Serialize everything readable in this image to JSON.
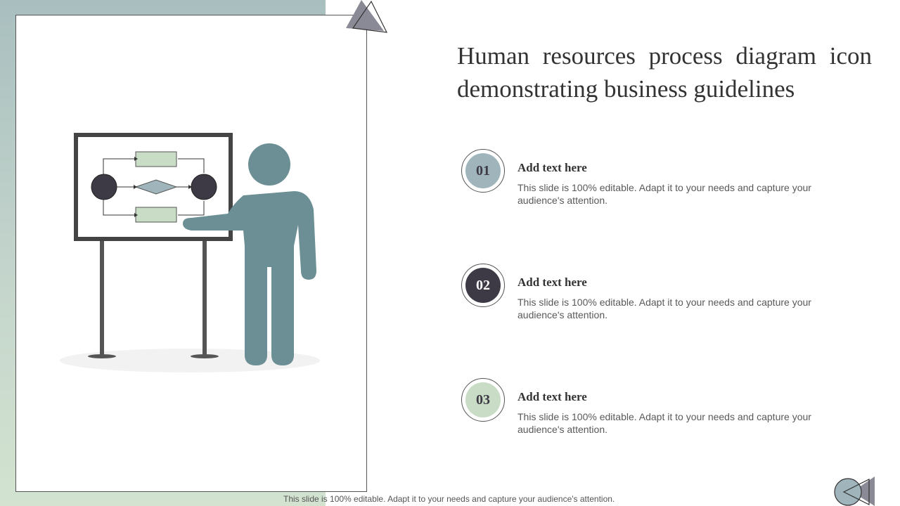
{
  "slide": {
    "title": "Human resources process diagram icon demonstrating  business guidelines",
    "items": [
      {
        "number": "01",
        "heading": "Add text here",
        "body": "This slide is 100% editable. Adapt it to your needs and capture your audience's attention.",
        "color": "#9fb5bb",
        "text_color": "#3d3a45"
      },
      {
        "number": "02",
        "heading": "Add text here",
        "body": "This slide is 100% editable. Adapt it to your needs and capture your audience's attention.",
        "color": "#3d3a45",
        "text_color": "#ffffff"
      },
      {
        "number": "03",
        "heading": "Add text here",
        "body": "This slide is 100% editable. Adapt it to your needs and capture your audience's attention.",
        "color": "#c9dcc5",
        "text_color": "#3d3a45"
      }
    ],
    "footer": "This slide is 100% editable. Adapt it to your needs and capture your audience's attention."
  },
  "colors": {
    "accent_teal": "#6b8f94",
    "dark": "#3d3a45",
    "light_green": "#c9dcc5",
    "board_frame": "#444444"
  },
  "icons": [
    "presenter-icon",
    "flowchart-board-icon",
    "corner-triangle-icon",
    "navigation-icon"
  ]
}
